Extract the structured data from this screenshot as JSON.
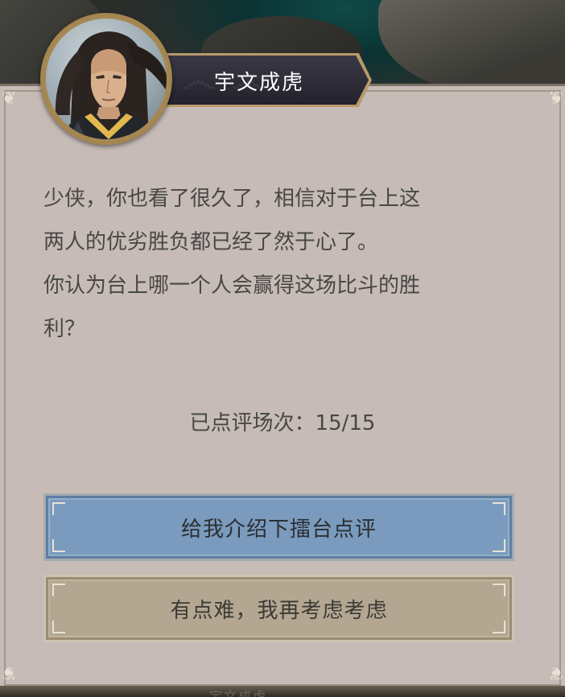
{
  "npc": {
    "name": "宇文成虎",
    "portrait": "long-haired-swordsman-portrait"
  },
  "dialogue": {
    "line1": "少侠，你也看了很久了，相信对于台上这",
    "line2": "两人的优劣胜负都已经了然于心了。",
    "line3": "你认为台上哪一个人会赢得这场比斗的胜",
    "line4": "利？"
  },
  "review_count": {
    "label": "已点评场次：",
    "value": "15/15"
  },
  "options": {
    "primary_label": "给我介绍下擂台点评",
    "secondary_label": "有点难，我再考虑考虑"
  },
  "ghost": {
    "text": "宇文成虎"
  },
  "colors": {
    "panel": "#c6bbb7",
    "primary_button": "#7a9bbd",
    "secondary_button": "#b4a791",
    "nameplate": "#2c2b36",
    "text": "#484744"
  }
}
